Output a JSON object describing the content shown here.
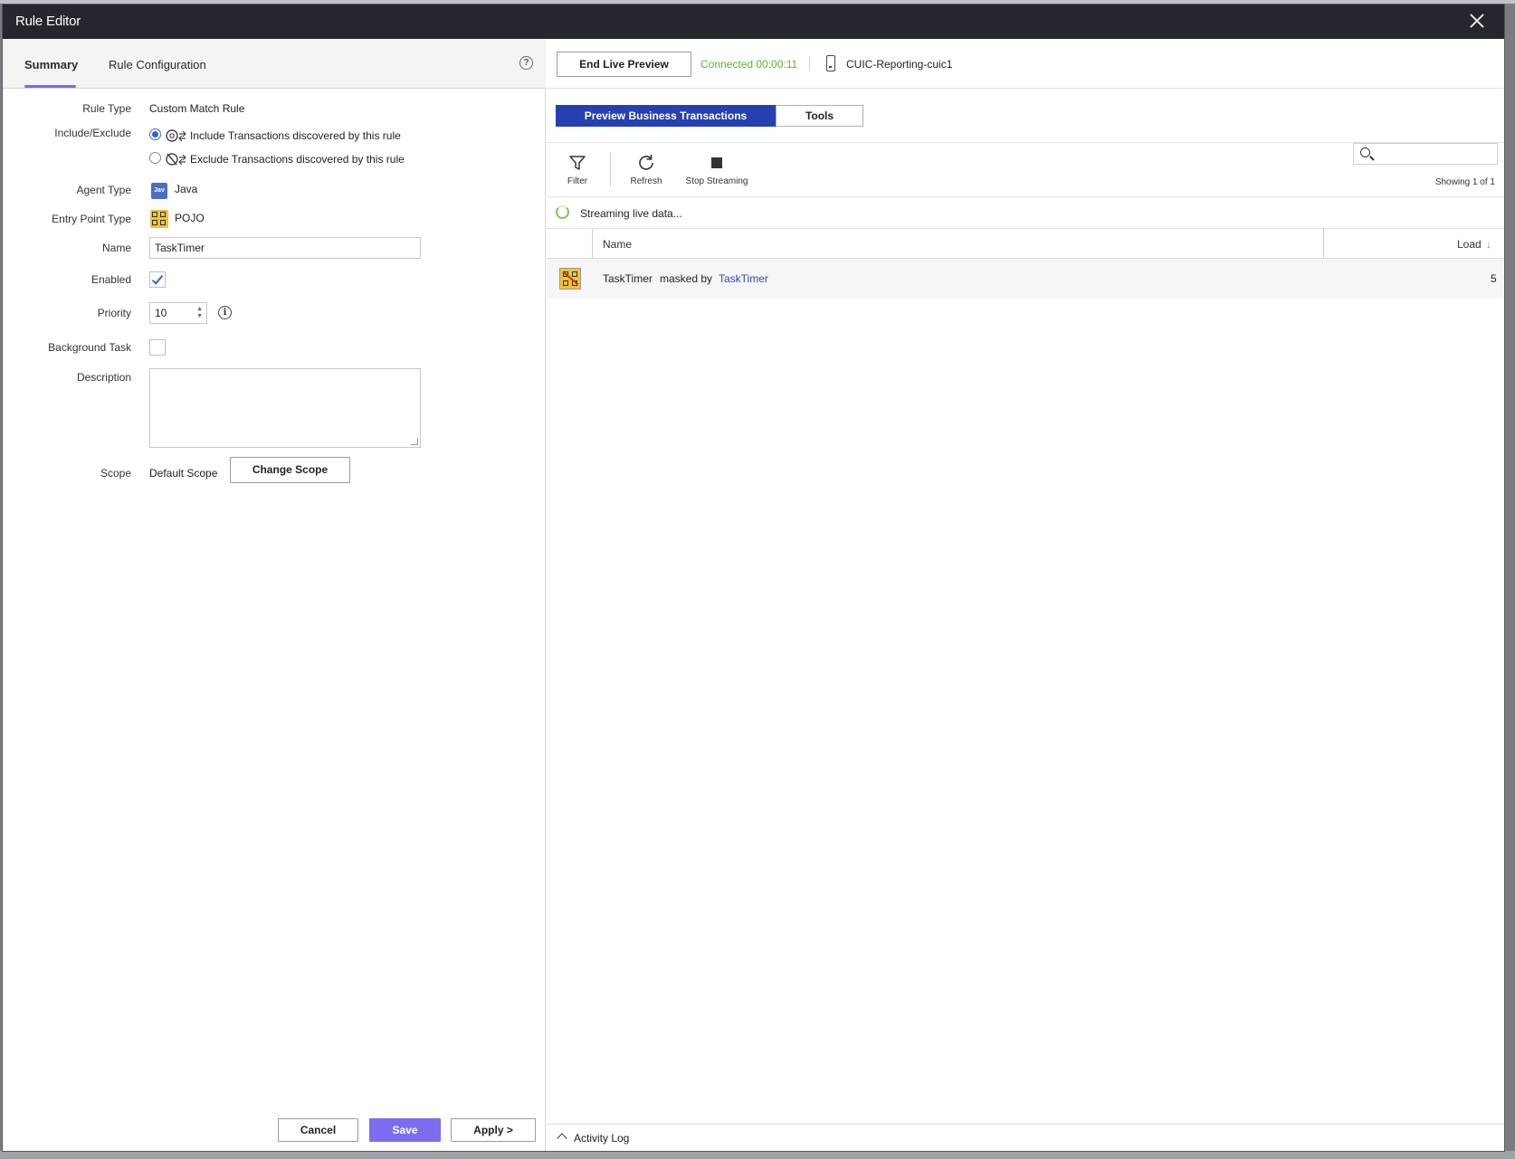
{
  "dialog": {
    "title": "Rule Editor"
  },
  "left": {
    "tabs": [
      {
        "label": "Summary",
        "active": true
      },
      {
        "label": "Rule Configuration",
        "active": false
      }
    ],
    "help_glyph": "?",
    "form": {
      "rule_type_label": "Rule Type",
      "rule_type_value": "Custom Match Rule",
      "include_exclude_label": "Include/Exclude",
      "include_option": "Include Transactions discovered by this rule",
      "exclude_option": "Exclude Transactions discovered by this rule",
      "include_selected": true,
      "agent_type_label": "Agent Type",
      "agent_type_icon_text": "Jav",
      "agent_type_value": "Java",
      "entry_point_label": "Entry Point Type",
      "entry_point_value": "POJO",
      "name_label": "Name",
      "name_value": "TaskTimer",
      "enabled_label": "Enabled",
      "enabled_checked": true,
      "priority_label": "Priority",
      "priority_value": "10",
      "info_glyph": "i",
      "background_task_label": "Background Task",
      "background_task_checked": false,
      "description_label": "Description",
      "description_value": "",
      "scope_label": "Scope",
      "scope_value": "Default Scope",
      "change_scope_label": "Change Scope"
    },
    "footer": {
      "cancel_label": "Cancel",
      "save_label": "Save",
      "apply_label": "Apply >"
    }
  },
  "right": {
    "end_preview_label": "End Live Preview",
    "connection_status": "Connected 00:00:11",
    "server_name": "CUIC-Reporting-cuic1",
    "segments": [
      {
        "label": "Preview Business Transactions",
        "active": true
      },
      {
        "label": "Tools",
        "active": false
      }
    ],
    "toolbar": {
      "filter_label": "Filter",
      "refresh_label": "Refresh",
      "stop_label": "Stop Streaming"
    },
    "search_placeholder": "",
    "showing_text": "Showing 1 of 1",
    "streaming_text": "Streaming live data...",
    "table": {
      "columns": [
        "Name",
        "Load"
      ],
      "sort_indicator": "↓",
      "rows": [
        {
          "name": "TaskTimer",
          "masked_text": "masked by",
          "masked_link": "TaskTimer",
          "load": "5"
        }
      ]
    },
    "activity_log_label": "Activity Log"
  },
  "colors": {
    "accent_purple": "#7c6cf0",
    "segment_blue": "#2540b0",
    "connected_green": "#5fb32b",
    "link_blue": "#2a48b8",
    "titlebar": "#24272d"
  }
}
